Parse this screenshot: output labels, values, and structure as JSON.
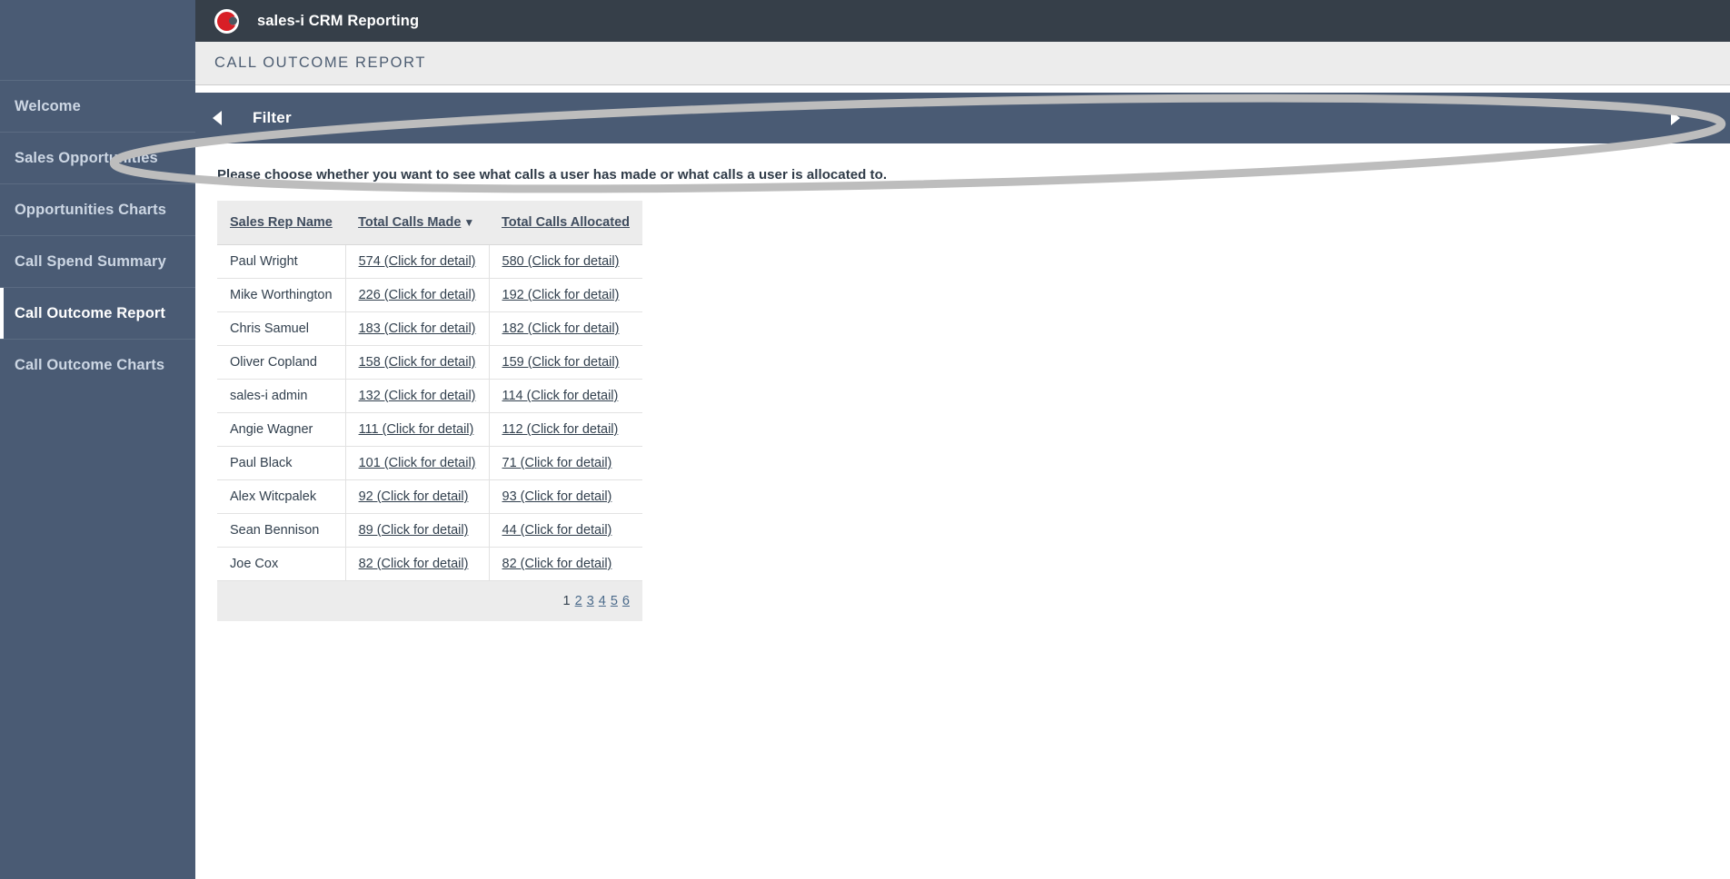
{
  "header": {
    "brand_title": "sales-i CRM Reporting",
    "logo_icon": "sales-i-logo-icon"
  },
  "page": {
    "title": "CALL OUTCOME REPORT",
    "instruction": "Please choose whether you want to see what calls a user has made or what calls a user is allocated to."
  },
  "sidebar": {
    "items": [
      {
        "label": "Welcome",
        "active": false
      },
      {
        "label": "Sales Opportunities",
        "active": false
      },
      {
        "label": "Opportunities Charts",
        "active": false
      },
      {
        "label": "Call Spend Summary",
        "active": false
      },
      {
        "label": "Call Outcome Report",
        "active": true
      },
      {
        "label": "Call Outcome Charts",
        "active": false
      }
    ]
  },
  "filter": {
    "label": "Filter",
    "left_arrow_icon": "triangle-left-icon",
    "right_arrow_icon": "triangle-right-icon"
  },
  "table": {
    "columns": [
      {
        "label": "Sales Rep Name",
        "sorted": false,
        "caret": ""
      },
      {
        "label": "Total Calls Made",
        "sorted": true,
        "caret": "▼"
      },
      {
        "label": "Total Calls Allocated",
        "sorted": false,
        "caret": ""
      }
    ],
    "detail_suffix": "(Click for detail)",
    "rows": [
      {
        "name": "Paul Wright",
        "made": "574 (Click for detail)",
        "allocated": "580 (Click for detail)"
      },
      {
        "name": "Mike Worthington",
        "made": "226 (Click for detail)",
        "allocated": "192 (Click for detail)"
      },
      {
        "name": "Chris Samuel",
        "made": "183 (Click for detail)",
        "allocated": "182 (Click for detail)"
      },
      {
        "name": "Oliver Copland",
        "made": "158 (Click for detail)",
        "allocated": "159 (Click for detail)"
      },
      {
        "name": "sales-i admin",
        "made": "132 (Click for detail)",
        "allocated": "114 (Click for detail)"
      },
      {
        "name": "Angie Wagner",
        "made": "111 (Click for detail)",
        "allocated": "112 (Click for detail)"
      },
      {
        "name": "Paul Black",
        "made": "101 (Click for detail)",
        "allocated": "71 (Click for detail)"
      },
      {
        "name": "Alex Witcpalek",
        "made": "92 (Click for detail)",
        "allocated": "93 (Click for detail)"
      },
      {
        "name": "Sean Bennison",
        "made": "89 (Click for detail)",
        "allocated": "44 (Click for detail)"
      },
      {
        "name": "Joe Cox",
        "made": "82 (Click for detail)",
        "allocated": "82 (Click for detail)"
      }
    ],
    "pagination": {
      "current": "1",
      "pages": [
        "2",
        "3",
        "4",
        "5",
        "6"
      ]
    }
  },
  "annotation": {
    "shape": "ellipse-highlight",
    "color": "#bdbdbd"
  },
  "colors": {
    "sidebar_bg": "#4a5b74",
    "topbar_bg": "#363f49",
    "filter_bg": "#4a5b74",
    "title_bar_bg": "#ececec",
    "brand_red": "#d81f26",
    "link": "#32404e"
  }
}
